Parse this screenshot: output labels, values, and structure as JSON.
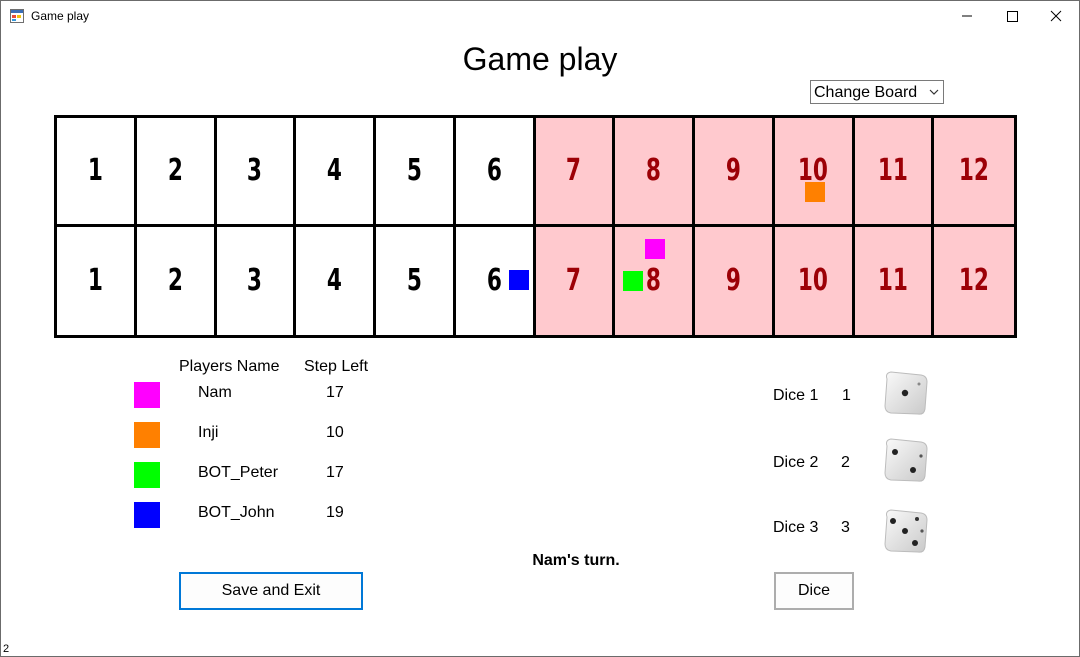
{
  "window": {
    "title": "Game play"
  },
  "page_title": "Game play",
  "board_selector": {
    "value": "Change Board"
  },
  "board": {
    "rows": [
      {
        "cells": [
          "1",
          "2",
          "3",
          "4",
          "5",
          "6",
          "7",
          "8",
          "9",
          "10",
          "11",
          "12"
        ]
      },
      {
        "cells": [
          "1",
          "2",
          "3",
          "4",
          "5",
          "6",
          "7",
          "8",
          "9",
          "10",
          "11",
          "12"
        ]
      }
    ]
  },
  "tokens": [
    {
      "player": "Nam",
      "color": "#ff00ff",
      "row": 2,
      "cell": 8
    },
    {
      "player": "Inji",
      "color": "#ff8000",
      "row": 1,
      "cell": 10
    },
    {
      "player": "BOT_Peter",
      "color": "#00ff00",
      "row": 2,
      "cell": 8
    },
    {
      "player": "BOT_John",
      "color": "#0000ff",
      "row": 2,
      "cell": 6
    }
  ],
  "players_table": {
    "headers": {
      "name": "Players Name",
      "steps": "Step Left"
    },
    "rows": [
      {
        "name": "Nam",
        "steps": "17",
        "color": "#ff00ff"
      },
      {
        "name": "Inji",
        "steps": "10",
        "color": "#ff8000"
      },
      {
        "name": "BOT_Peter",
        "steps": "17",
        "color": "#00ff00"
      },
      {
        "name": "BOT_John",
        "steps": "19",
        "color": "#0000ff"
      }
    ]
  },
  "dice": [
    {
      "label": "Dice 1",
      "value": "1"
    },
    {
      "label": "Dice 2",
      "value": "2"
    },
    {
      "label": "Dice 3",
      "value": "3"
    }
  ],
  "turn_text": "Nam's turn.",
  "buttons": {
    "save_exit": "Save and Exit",
    "dice": "Dice"
  },
  "corner_label": "2",
  "icons": {
    "app": "app-icon",
    "minimize": "minimize-icon",
    "maximize": "maximize-icon",
    "close": "close-icon",
    "chevron": "chevron-down-icon",
    "die": "die-icon"
  }
}
